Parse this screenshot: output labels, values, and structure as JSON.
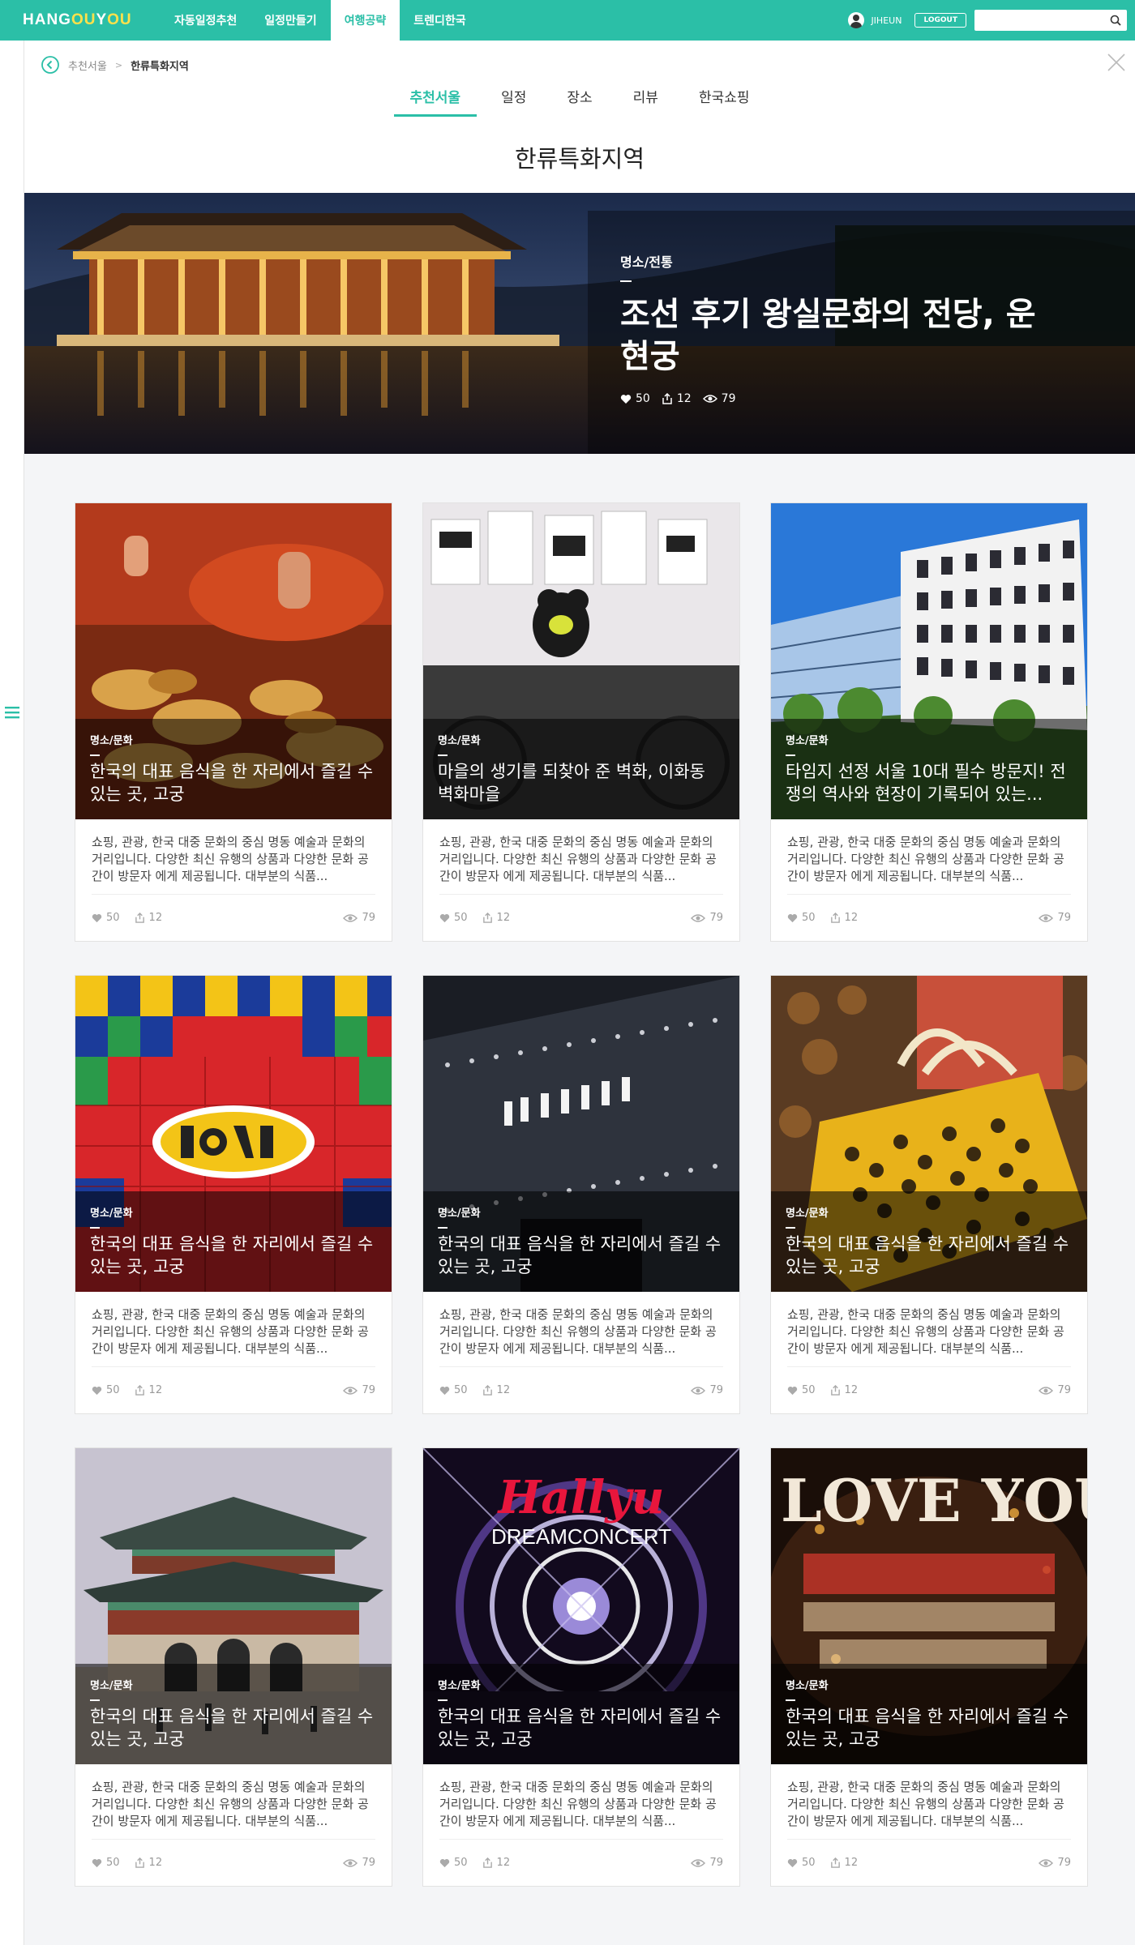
{
  "topnav": {
    "logo_main": "HANG",
    "logo_accent": "OU",
    "logo_rest": "Y",
    "logo_accent2": "OU",
    "items": [
      "자동일정추천",
      "일정만들기",
      "여행공략",
      "트렌디한국"
    ],
    "active_index": 2,
    "username": "JIHEUN",
    "logout_label": "LOGOUT",
    "search_value": ""
  },
  "breadcrumb": {
    "parent": "추천서울",
    "separator": ">",
    "current": "한류특화지역"
  },
  "tabs": [
    "추천서울",
    "일정",
    "장소",
    "리뷰",
    "한국쇼핑"
  ],
  "active_tab": 0,
  "page_title": "한류특화지역",
  "hero": {
    "category": "명소/전통",
    "title": "조선 후기 왕실문화의 전당, 운현궁",
    "likes": "50",
    "shares": "12",
    "views": "79"
  },
  "cards": [
    {
      "category": "명소/문화",
      "title": "한국의 대표 음식을 한 자리에서 즐길 수 있는 곳, 고궁",
      "desc": "쇼핑, 관광, 한국 대중 문화의 중심 명동 예술과 문화의 거리입니다. 다양한 최신 유행의 상품과 다양한 문화 공간이 방문자 에게 제공됩니다. 대부분의 식품...",
      "likes": "50",
      "shares": "12",
      "views": "79",
      "image": "street-food"
    },
    {
      "category": "명소/문화",
      "title": "마을의 생기를 되찾아 준 벽화, 이화동 벽화마을",
      "desc": "쇼핑, 관광, 한국 대중 문화의 중심 명동 예술과 문화의 거리입니다. 다양한 최신 유행의 상품과 다양한 문화 공간이 방문자 에게 제공됩니다. 대부분의 식품...",
      "likes": "50",
      "shares": "12",
      "views": "79",
      "image": "shop"
    },
    {
      "category": "명소/문화",
      "title": "타임지 선정 서울 10대 필수 방문지! 전쟁의 역사와 현장이 기록되어 있는...",
      "desc": "쇼핑, 관광, 한국 대중 문화의 중심 명동 예술과 문화의 거리입니다. 다양한 최신 유행의 상품과 다양한 문화 공간이 방문자 에게 제공됩니다. 대부분의 식품...",
      "likes": "50",
      "shares": "12",
      "views": "79",
      "image": "building"
    },
    {
      "category": "명소/문화",
      "title": "한국의 대표 음식을 한 자리에서 즐길 수 있는 곳, 고궁",
      "desc": "쇼핑, 관광, 한국 대중 문화의 중심 명동 예술과 문화의 거리입니다. 다양한 최신 유행의 상품과 다양한 문화 공간이 방문자 에게 제공됩니다. 대부분의 식품...",
      "likes": "50",
      "shares": "12",
      "views": "79",
      "image": "love"
    },
    {
      "category": "명소/문화",
      "title": "한국의 대표 음식을 한 자리에서 즐길 수 있는 곳, 고궁",
      "desc": "쇼핑, 관광, 한국 대중 문화의 중심 명동 예술과 문화의 거리입니다. 다양한 최신 유행의 상품과 다양한 문화 공간이 방문자 에게 제공됩니다. 대부분의 식품...",
      "likes": "50",
      "shares": "12",
      "views": "79",
      "image": "smtown"
    },
    {
      "category": "명소/문화",
      "title": "한국의 대표 음식을 한 자리에서 즐길 수 있는 곳, 고궁",
      "desc": "쇼핑, 관광, 한국 대중 문화의 중심 명동 예술과 문화의 거리입니다. 다양한 최신 유행의 상품과 다양한 문화 공간이 방문자 에게 제공됩니다. 대부분의 식품...",
      "likes": "50",
      "shares": "12",
      "views": "79",
      "image": "bag"
    },
    {
      "category": "명소/문화",
      "title": "한국의 대표 음식을 한 자리에서 즐길 수 있는 곳, 고궁",
      "desc": "쇼핑, 관광, 한국 대중 문화의 중심 명동 예술과 문화의 거리입니다. 다양한 최신 유행의 상품과 다양한 문화 공간이 방문자 에게 제공됩니다. 대부분의 식품...",
      "likes": "50",
      "shares": "12",
      "views": "79",
      "image": "palace-gate"
    },
    {
      "category": "명소/문화",
      "title": "한국의 대표 음식을 한 자리에서 즐길 수 있는 곳, 고궁",
      "desc": "쇼핑, 관광, 한국 대중 문화의 중심 명동 예술과 문화의 거리입니다. 다양한 최신 유행의 상품과 다양한 문화 공간이 방문자 에게 제공됩니다. 대부분의 식품...",
      "likes": "50",
      "shares": "12",
      "views": "79",
      "image": "concert",
      "image_text": "Hallyu",
      "image_subtext": "DREAMCONCERT"
    },
    {
      "category": "명소/문화",
      "title": "한국의 대표 음식을 한 자리에서 즐길 수 있는 곳, 고궁",
      "desc": "쇼핑, 관광, 한국 대중 문화의 중심 명동 예술과 문화의 거리입니다. 다양한 최신 유행의 상품과 다양한 문화 공간이 방문자 에게 제공됩니다. 대부분의 식품...",
      "likes": "50",
      "shares": "12",
      "views": "79",
      "image": "i-love-you",
      "image_text": "I LOVE YOU"
    }
  ],
  "colors": {
    "brand": "#2bbfa7",
    "accent": "#ffe14a"
  }
}
